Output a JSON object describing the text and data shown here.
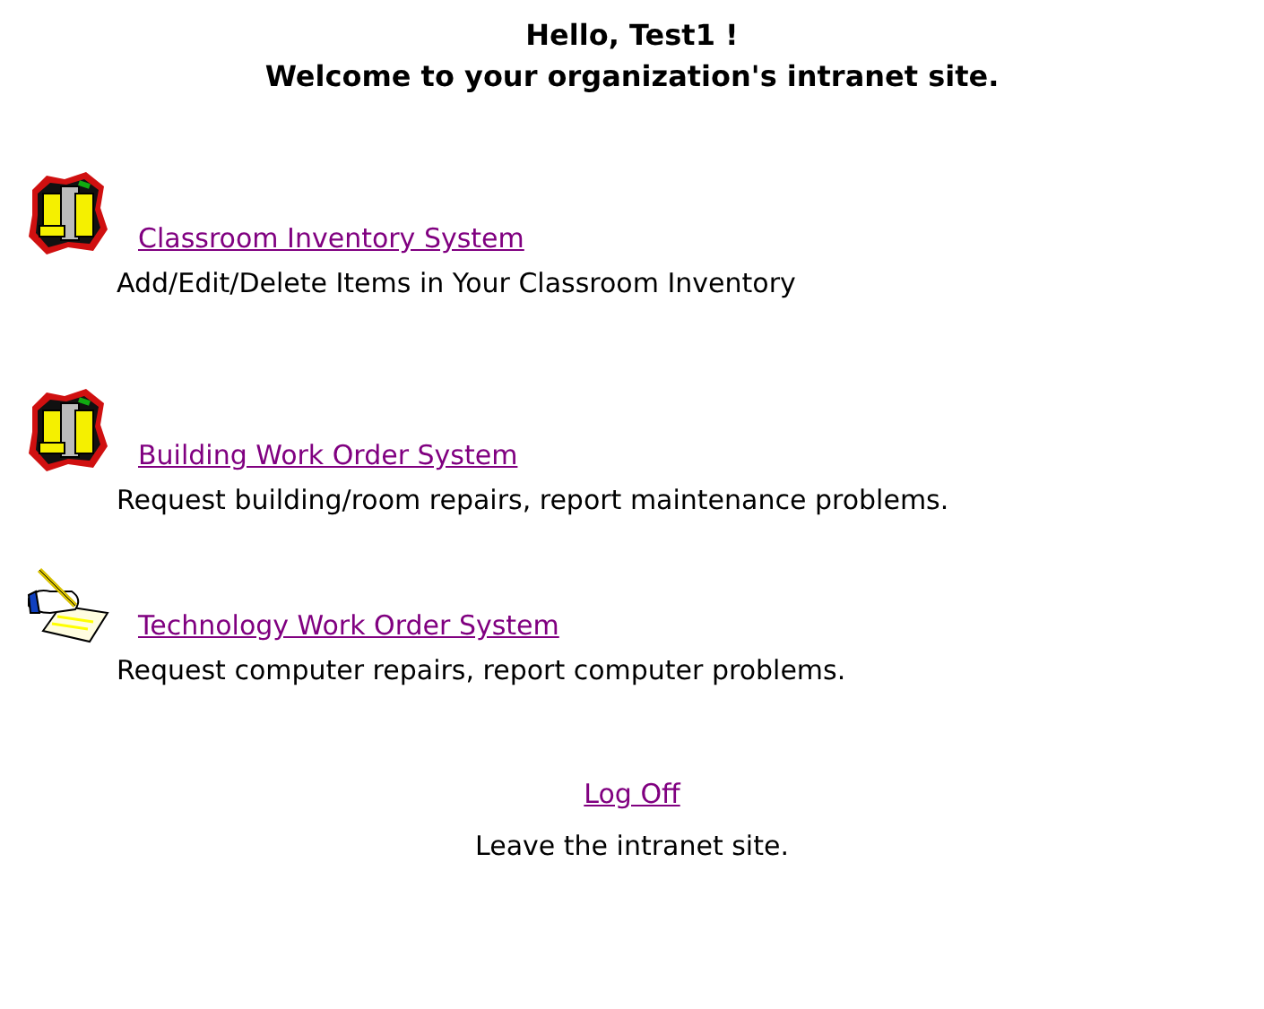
{
  "greeting": "Hello, Test1 !",
  "welcome": "Welcome to your organization's intranet site.",
  "systems": [
    {
      "kind": "building",
      "link": "Classroom Inventory System",
      "description": "Add/Edit/Delete Items in Your Classroom Inventory"
    },
    {
      "kind": "building",
      "link": "Building Work Order System",
      "description": "Request building/room repairs, report maintenance problems."
    },
    {
      "kind": "notepad",
      "link": "Technology Work Order System",
      "description": "Request computer repairs, report computer problems."
    }
  ],
  "logoff": {
    "link": "Log Off",
    "description": "Leave the intranet site."
  }
}
